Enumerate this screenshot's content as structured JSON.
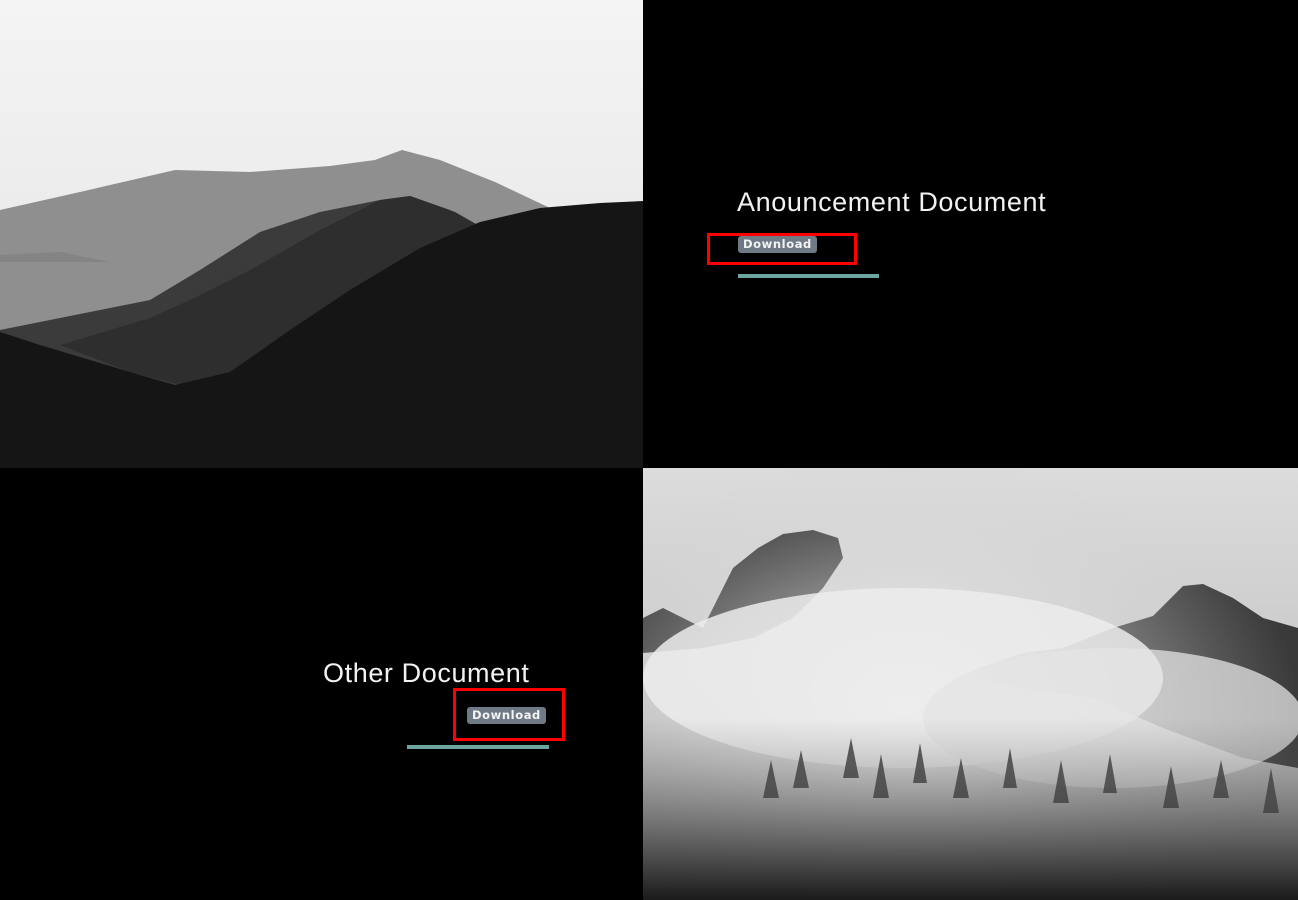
{
  "sections": [
    {
      "title": "Anouncement Document",
      "button_label": "Download"
    },
    {
      "title": "Other Document",
      "button_label": "Download"
    }
  ],
  "images": [
    {
      "subject": "layered mountain silhouettes"
    },
    {
      "subject": "misty mountain peaks with forest"
    }
  ],
  "colors": {
    "background": "#000000",
    "title_text": "#f2f2f2",
    "button_bg": "#6f7a86",
    "accent_bar": "#6fa5a0",
    "highlight": "#ff0000"
  }
}
